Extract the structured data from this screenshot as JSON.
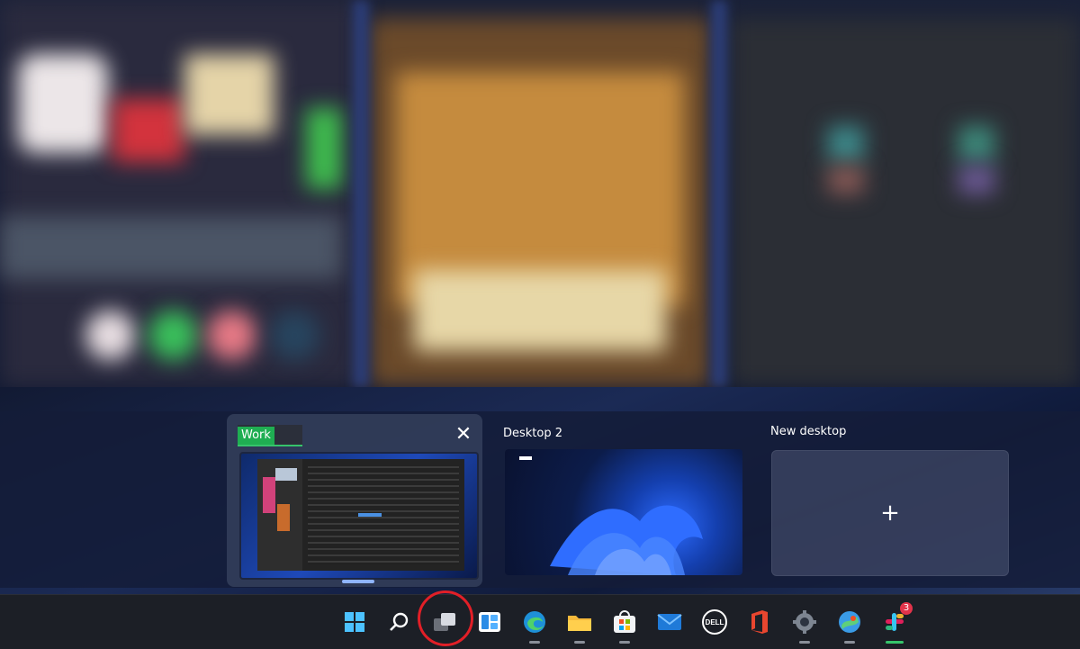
{
  "task_view": {
    "desktops": [
      {
        "name": "Work",
        "close_label": "✕"
      },
      {
        "name": "Desktop 2"
      }
    ],
    "new_desktop": {
      "label": "New desktop",
      "plus": "+"
    }
  },
  "taskbar": {
    "items": [
      {
        "id": "start",
        "icon": "windows-start-icon"
      },
      {
        "id": "search",
        "icon": "search-icon"
      },
      {
        "id": "task-view",
        "icon": "task-view-icon"
      },
      {
        "id": "widgets",
        "icon": "widgets-icon"
      },
      {
        "id": "edge",
        "icon": "edge-icon"
      },
      {
        "id": "file-explorer",
        "icon": "folder-icon"
      },
      {
        "id": "store",
        "icon": "store-icon"
      },
      {
        "id": "mail",
        "icon": "mail-icon"
      },
      {
        "id": "dell",
        "icon": "dell-icon",
        "text": "DELL"
      },
      {
        "id": "office",
        "icon": "office-icon"
      },
      {
        "id": "settings",
        "icon": "gear-icon"
      },
      {
        "id": "maps",
        "icon": "maps-icon"
      },
      {
        "id": "slack",
        "icon": "slack-icon",
        "badge": "3"
      }
    ]
  },
  "colors": {
    "accent_green": "#1fae52",
    "highlight_red": "#e21f27"
  }
}
